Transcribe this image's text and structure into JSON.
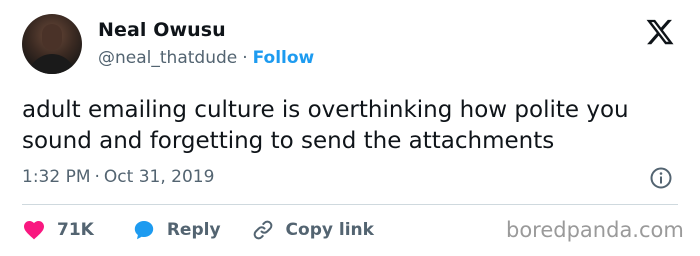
{
  "author": {
    "name": "Neal Owusu",
    "handle": "@neal_thatdude",
    "separator": "·",
    "follow_label": "Follow"
  },
  "tweet": {
    "text": "adult emailing culture is overthinking how polite you sound and forgetting to send the attachments",
    "time": "1:32 PM",
    "separator": "·",
    "date": "Oct 31, 2019"
  },
  "actions": {
    "like_count": "71K",
    "reply_label": "Reply",
    "copy_link_label": "Copy link"
  },
  "watermark": "boredpanda.com",
  "colors": {
    "accent": "#1d9bf0",
    "like": "#f91880",
    "text": "#0f1419",
    "secondary": "#536471"
  },
  "icons": {
    "platform": "x-logo-icon",
    "info": "info-icon",
    "like": "heart-icon",
    "reply": "reply-bubble-icon",
    "copy": "link-icon"
  }
}
